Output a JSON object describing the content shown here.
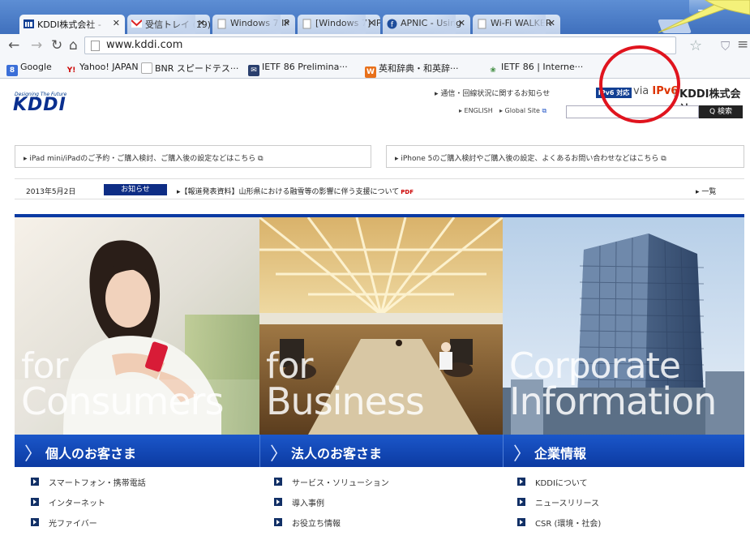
{
  "browser": {
    "tabs": [
      {
        "label": "KDDI株式会社 -",
        "active": true
      },
      {
        "label": "受信トレイ (19)",
        "active": false
      },
      {
        "label": "Windows 7 IP",
        "active": false
      },
      {
        "label": "[Windows 7] IP",
        "active": false
      },
      {
        "label": "APNIC - Using",
        "active": false
      },
      {
        "label": "Wi-Fi WALKER",
        "active": false
      }
    ],
    "url": "www.kddi.com",
    "bookmarks": [
      "Google",
      "Yahoo! JAPAN",
      "BNR スピードテス···",
      "IETF 86 Prelimina···",
      "英和辞典・和英辞···",
      "IETF 86 | Interne···"
    ]
  },
  "site": {
    "logo_tagline": "Designing The Future",
    "logo": "KDDI",
    "notice_link": "▸ 通信・回線状況に関するお知らせ",
    "ipv6_badge": "IPv6 対応",
    "ipv6_via": "via",
    "ipv6_label": "IPv6",
    "separator": "|",
    "company": "KDDI株式会社",
    "english_link": "▸ ENGLISH",
    "global_link": "▸ Global Site",
    "search_button": "Q 検索",
    "promos": [
      "▸ iPad mini/iPadのご予約・ご購入検討、ご購入後の設定などはこちら",
      "▸ iPhone 5のご購入検討やご購入後の設定、よくあるお問い合わせなどはこちら"
    ],
    "news": {
      "date": "2013年5月2日",
      "tag": "お知らせ",
      "text": "▸【報道発表資料】山形県における融雪等の影響に伴う支援について",
      "pdf": "PDF",
      "all": "▸ 一覧"
    },
    "panels": [
      {
        "line1": "for",
        "line2": "Consumers",
        "band": "個人のお客さま",
        "links": [
          "スマートフォン・携帯電話",
          "インターネット",
          "光ファイバー"
        ]
      },
      {
        "line1": "for",
        "line2": "Business",
        "band": "法人のお客さま",
        "links": [
          "サービス・ソリューション",
          "導入事例",
          "お役立ち情報"
        ]
      },
      {
        "line1": "Corporate",
        "line2": "Information",
        "band": "企業情報",
        "links": [
          "KDDIについて",
          "ニュースリリース",
          "CSR (環境・社会)"
        ]
      }
    ]
  },
  "colors": {
    "brand_blue": "#0c3aa2",
    "annotation_red": "#e0141e",
    "callout_yellow": "#f4f17a"
  }
}
